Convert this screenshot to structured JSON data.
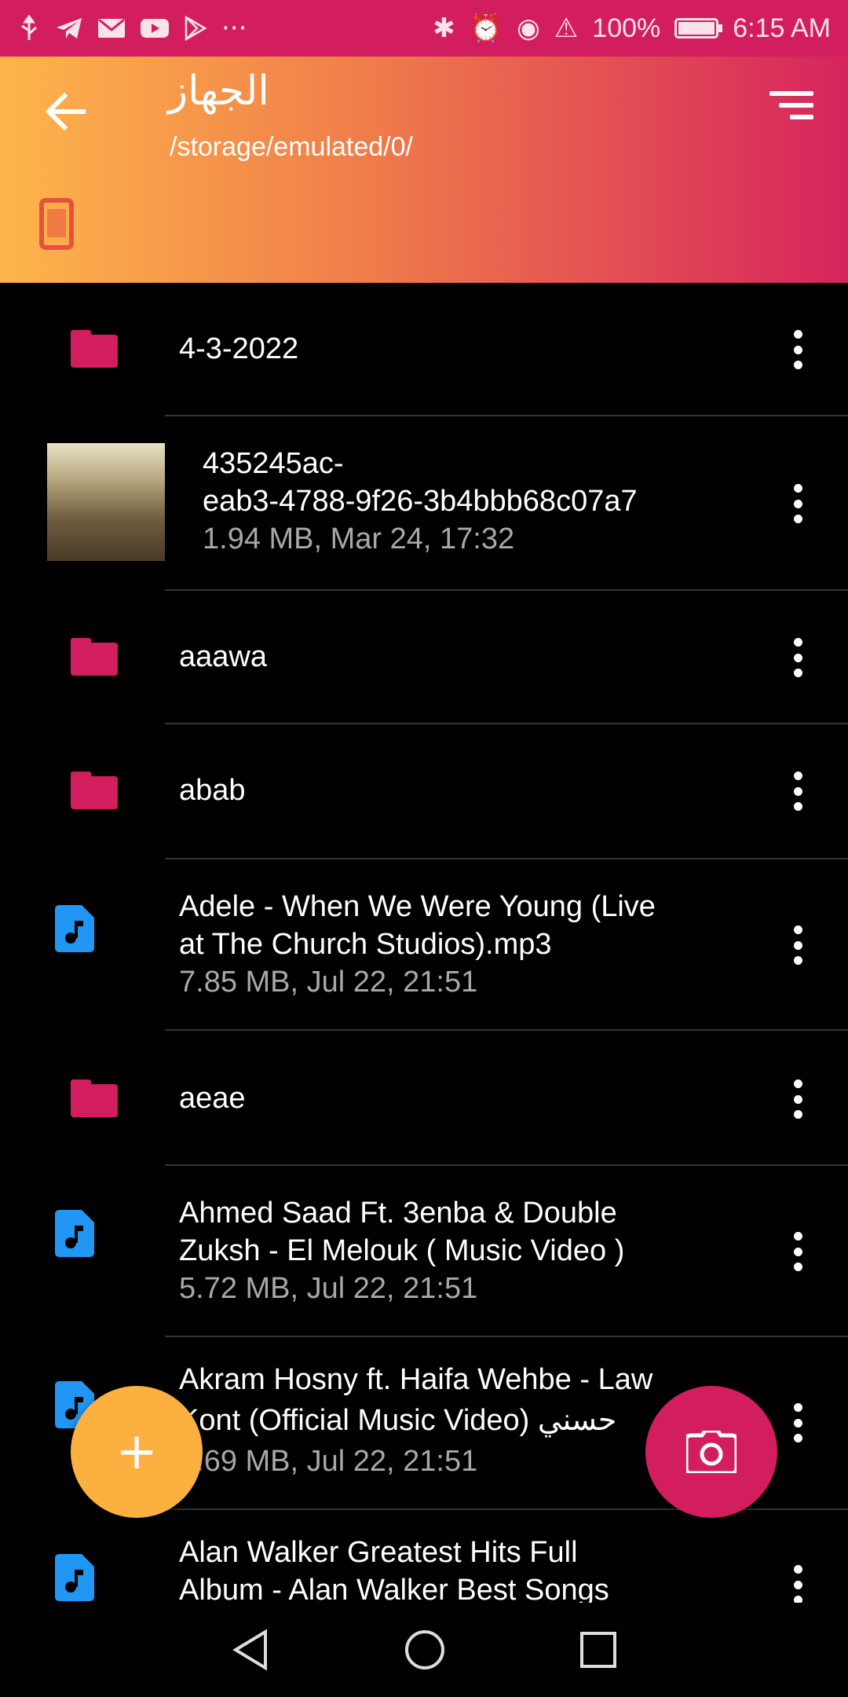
{
  "status_bar": {
    "left_icons": [
      "usb-icon",
      "telegram-icon",
      "gmail-icon",
      "youtube-icon",
      "play-store-icon"
    ],
    "more": "···",
    "right_icons": [
      "bluetooth-icon",
      "alarm-icon",
      "eye-comfort-icon",
      "alert-icon"
    ],
    "battery": "100%",
    "battery_level": 1.0,
    "time": "6:15 AM"
  },
  "header": {
    "title": "الجهاز",
    "path": "/storage/emulated/0/",
    "back_icon": "arrow-left-icon",
    "sort_icon": "sort-icon",
    "storage_icon": "phone-icon",
    "colors": {
      "start": "#fdb54b",
      "end": "#d6245d"
    }
  },
  "files": [
    {
      "type": "folder",
      "name": "4-3-2022"
    },
    {
      "type": "image",
      "name_line1": "435245ac-",
      "name_line2": "eab3-4788-9f26-3b4bbb68c07a7",
      "meta": "1.94 MB, Mar 24, 17:32"
    },
    {
      "type": "folder",
      "name": "aaawa"
    },
    {
      "type": "folder",
      "name": "abab"
    },
    {
      "type": "audio",
      "name_line1": "Adele - When We Were Young (Live",
      "name_line2": "at The Church Studios).mp3",
      "meta": "7.85 MB, Jul 22, 21:51"
    },
    {
      "type": "folder",
      "name": "aeae"
    },
    {
      "type": "audio",
      "name_line1": "Ahmed Saad Ft. 3enba & Double",
      "name_line2": "Zuksh - El Melouk ( Music Video )",
      "meta": "5.72 MB, Jul 22, 21:51"
    },
    {
      "type": "audio",
      "name_line1": "Akram Hosny ft. Haifa Wehbe - Law",
      "name_line2": "Kont (Official Music Video) حسني",
      "meta": "3.69 MB, Jul 22, 21:51"
    },
    {
      "type": "audio",
      "name_line1": "Alan Walker Greatest Hits Full",
      "name_line2": "Album - Alan Walker Best Songs"
    }
  ],
  "fab": {
    "add_symbol": "+",
    "add_color": "#fbb040",
    "camera_icon": "camera-icon",
    "camera_color": "#d21d5e"
  },
  "navbar": {
    "back": "nav-back-icon",
    "home": "nav-home-icon",
    "recents": "nav-recents-icon"
  }
}
